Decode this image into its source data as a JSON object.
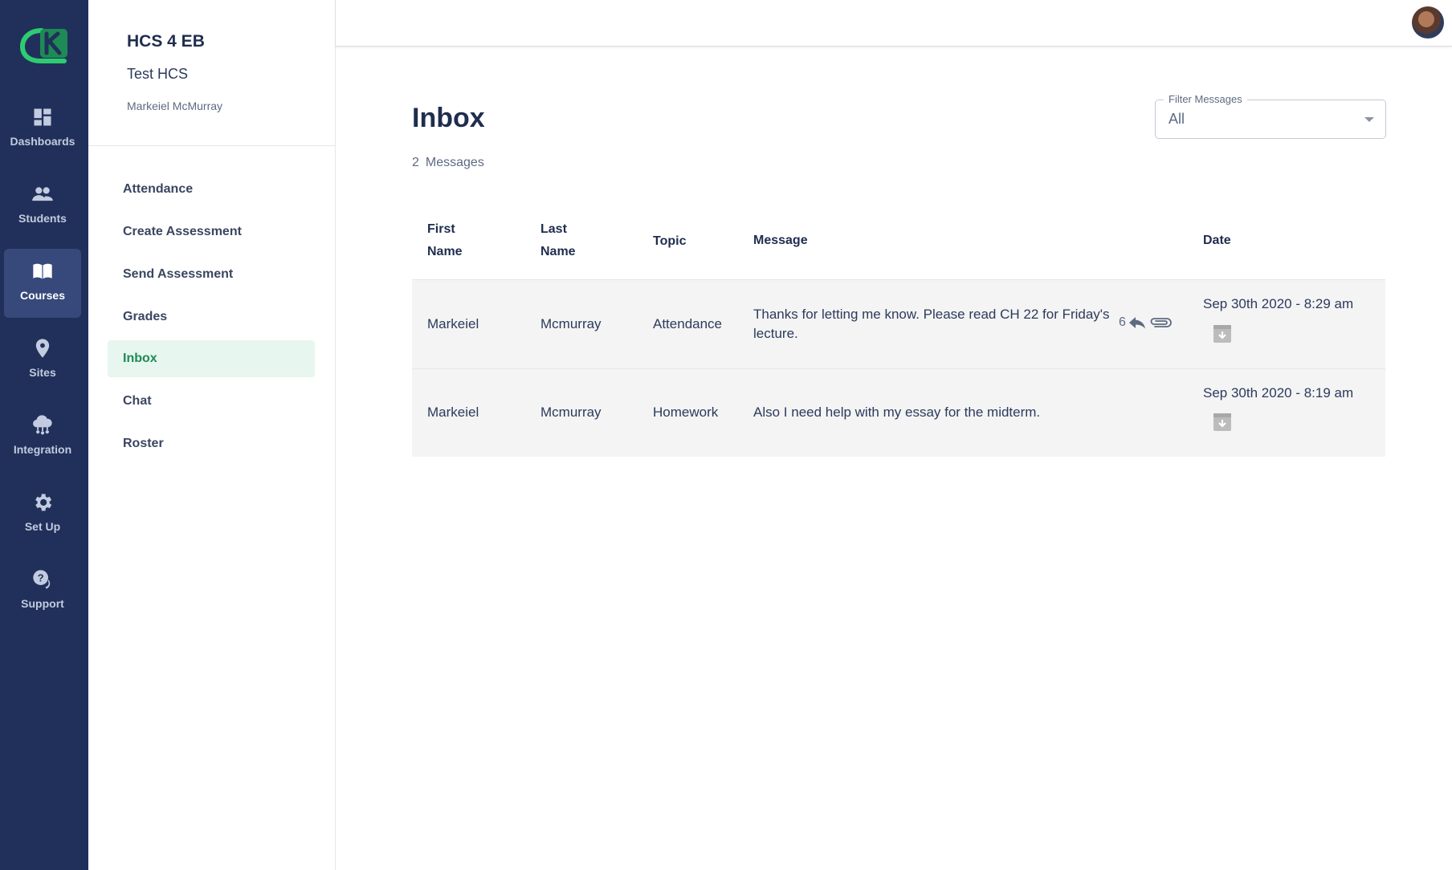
{
  "nav": {
    "logo": "CK",
    "items": [
      {
        "label": "Dashboards",
        "icon": "dashboard-icon",
        "active": false
      },
      {
        "label": "Students",
        "icon": "people-icon",
        "active": false
      },
      {
        "label": "Courses",
        "icon": "book-icon",
        "active": true
      },
      {
        "label": "Sites",
        "icon": "map-pin-icon",
        "active": false
      },
      {
        "label": "Integration",
        "icon": "cloud-network-icon",
        "active": false
      },
      {
        "label": "Set Up",
        "icon": "gear-icon",
        "active": false
      },
      {
        "label": "Support",
        "icon": "help-chat-icon",
        "active": false
      }
    ]
  },
  "course": {
    "title": "HCS 4 EB",
    "subtitle": "Test HCS",
    "owner": "Markeiel McMurray",
    "menu": [
      "Attendance",
      "Create Assessment",
      "Send Assessment",
      "Grades",
      "Inbox",
      "Chat",
      "Roster"
    ],
    "active_menu": "Inbox"
  },
  "page": {
    "title": "Inbox",
    "count": "2",
    "count_label": "Messages"
  },
  "filter": {
    "label": "Filter Messages",
    "value": "All"
  },
  "table": {
    "headers": {
      "first_name": [
        "First",
        "Name"
      ],
      "last_name": [
        "Last",
        "Name"
      ],
      "topic": "Topic",
      "message": "Message",
      "date": "Date"
    },
    "rows": [
      {
        "first": "Markeiel",
        "last": "Mcmurray",
        "topic": "Attendance",
        "message": "Thanks for letting me know. Please read CH 22 for Friday's lecture.",
        "replies": "6",
        "has_attachment": true,
        "date": "Sep 30th 2020 - 8:29 am"
      },
      {
        "first": "Markeiel",
        "last": "Mcmurray",
        "topic": "Homework",
        "message": "Also I need help with my essay for the midterm.",
        "replies": "",
        "has_attachment": false,
        "date": "Sep 30th 2020 - 8:19 am"
      }
    ]
  },
  "colors": {
    "nav_bg": "#21305a",
    "accent_green": "#1e8a55",
    "active_menu_bg": "#e7f6ee"
  }
}
